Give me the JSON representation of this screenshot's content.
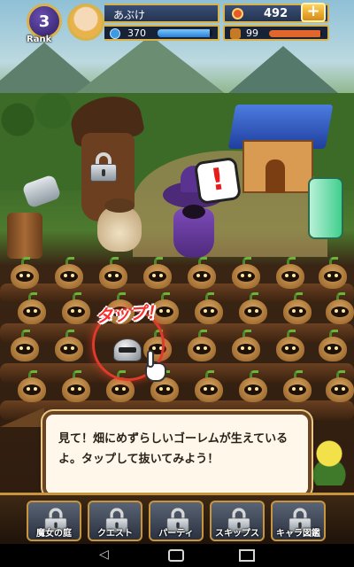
{
  "player": {
    "rank": "3",
    "rank_label": "Rank",
    "name": "あぶけ",
    "stamina": "370",
    "stamina_fraction": 0.95,
    "coins": "492",
    "coin_plus_label": "+",
    "growth": "99",
    "growth_fraction": 0.97
  },
  "scene": {
    "alert_mark": "!",
    "tap_label": "タップ！"
  },
  "dialog": {
    "text": "見て！畑にめずらしいゴーレムが生えているよ。タップして抜いてみよう！"
  },
  "bottom_nav": {
    "items": [
      {
        "label": "魔女の庭",
        "icon": "lock-icon",
        "locked": true
      },
      {
        "label": "クエスト",
        "icon": "lock-icon",
        "locked": true
      },
      {
        "label": "パーティ",
        "icon": "lock-icon",
        "locked": true
      },
      {
        "label": "スキップス",
        "icon": "lock-icon",
        "locked": true
      },
      {
        "label": "キャラ図鑑",
        "icon": "lock-icon",
        "locked": true
      }
    ]
  },
  "system_nav": {
    "back_icon": "back-icon",
    "home_icon": "home-icon",
    "recents_icon": "recents-icon"
  },
  "colors": {
    "accent_gold": "#d9b24a",
    "tap_red": "#e03a2a",
    "stamina_blue": "#2a7fd1"
  }
}
